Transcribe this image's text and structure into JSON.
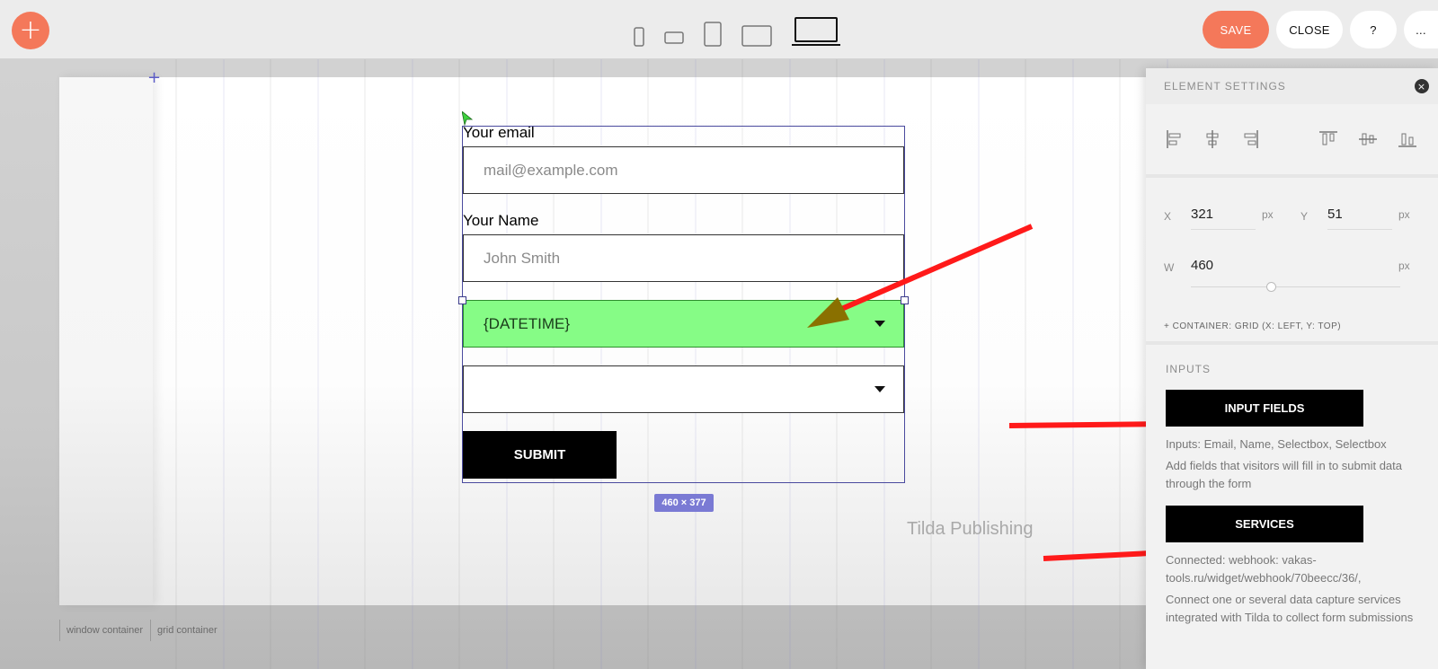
{
  "toolbar": {
    "save_label": "SAVE",
    "close_label": "CLOSE",
    "help_label": "?",
    "more_label": "..."
  },
  "form": {
    "email_label": "Your email",
    "email_placeholder": "mail@example.com",
    "name_label": "Your Name",
    "name_placeholder": "John Smith",
    "datetime_value": "{DATETIME}",
    "select2_value": "",
    "submit_label": "SUBMIT",
    "size_badge": "460 × 377"
  },
  "canvas": {
    "watermark": "Tilda Publishing",
    "window_container_label": "window container",
    "grid_container_label": "grid container"
  },
  "panel": {
    "title": "ELEMENT SETTINGS",
    "x_label": "X",
    "x_value": "321",
    "y_label": "Y",
    "y_value": "51",
    "w_label": "W",
    "w_value": "460",
    "unit": "px",
    "container_text": "+ CONTAINER: GRID (X: LEFT, Y: TOP)",
    "inputs_title": "INPUTS",
    "input_fields_button": "INPUT FIELDS",
    "inputs_summary": "Inputs: Email, Name, Selectbox, Selectbox",
    "inputs_desc": "Add fields that visitors will fill in to submit data through the form",
    "services_button": "SERVICES",
    "services_connected": "Connected: webhook: vakas-tools.ru/widget/webhook/70beecc/36/,",
    "services_desc": "Connect one or several data capture services integrated with Tilda to collect form submissions"
  },
  "colors": {
    "accent": "#f4785a",
    "selected_field": "#86fc86",
    "annotation_arrow": "#ff1a1a"
  }
}
